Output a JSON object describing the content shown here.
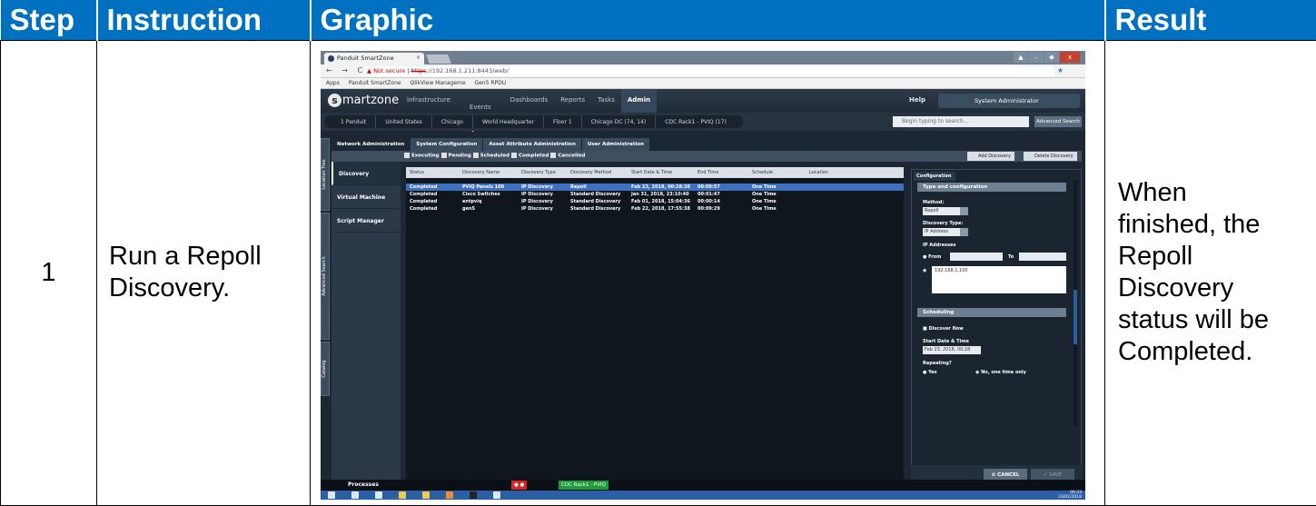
{
  "table": {
    "headers": [
      "Step",
      "Instruction",
      "Graphic",
      "Result"
    ],
    "row": {
      "step": "1",
      "instruction_lines": [
        "Run a Repoll",
        "Discovery."
      ],
      "result_lines": [
        "When",
        "finished, the",
        "Repoll",
        "Discovery",
        "status will be",
        "Completed."
      ]
    }
  },
  "screenshot": {
    "browser_tab": "Panduit SmartZone",
    "tab_close": "×",
    "window_controls": [
      "▲",
      "–",
      "◆",
      "x"
    ],
    "nav_glyphs": "← → C",
    "url_not_secure": "▲ Not secure",
    "url_https": "https",
    "url_rest": "://192.168.1.211:8443/web/",
    "bookmarks": [
      "Apps",
      "Panduit SmartZone",
      "QlikView Manageme",
      "Gen5 RPDU"
    ],
    "logo_initial": "s",
    "logo_text": "martzone",
    "main_nav": [
      "Infrastructure",
      "Events",
      "Dashboards",
      "Reports",
      "Tasks",
      "Admin"
    ],
    "events_badge": "1",
    "help": "Help",
    "user": "System Administrator",
    "breadcrumbs": [
      "1 Panduit",
      "United States",
      "Chicago",
      "World Headquarter",
      "Floor 1",
      "Chicago DC (74, 14)",
      "CDC Rack1 - PVIQ (17)"
    ],
    "search_placeholder": "Begin typing to search...",
    "advanced_search": "Advanced Search",
    "side_tabs": [
      "Location Tree",
      "Advanced Search",
      "Catalog"
    ],
    "admin_tabs": [
      "Network Administration",
      "System Configuration",
      "Asset Attribute Administration",
      "User Administration"
    ],
    "filters": [
      "Executing",
      "Pending",
      "Scheduled",
      "Completed",
      "Cancelled"
    ],
    "add_discovery": "Add Discovery",
    "delete_discovery": "Delete Discovery",
    "left_nav": [
      "Discovery",
      "Virtual Machine",
      "Script Manager"
    ],
    "grid_headers": [
      "Status",
      "Discovery Name",
      "Discovery Type",
      "Discovery Method",
      "Start Date & Time",
      "End Time",
      "Schedule",
      "Location"
    ],
    "grid_rows": [
      [
        "Completed",
        "PVIQ Panels 100",
        "IP Discovery",
        "Repoll",
        "Feb 23, 2018, 00:28:38",
        "00:09:57",
        "One Time",
        ""
      ],
      [
        "Completed",
        "Cisco Switches",
        "IP Discovery",
        "Standard Discovery",
        "Jan 31, 2018, 23:10:40",
        "00:01:47",
        "One Time",
        ""
      ],
      [
        "Completed",
        "entpviq",
        "IP Discovery",
        "Standard Discovery",
        "Feb 01, 2018, 15:04:36",
        "00:00:14",
        "One Time",
        ""
      ],
      [
        "Completed",
        "gen5",
        "IP Discovery",
        "Standard Discovery",
        "Feb 22, 2018, 17:55:38",
        "00:09:29",
        "One Time",
        ""
      ]
    ],
    "config": {
      "tab": "Configuration",
      "section_type": "Type and configuration",
      "method_label": "Method:",
      "method_value": "Repoll",
      "discovery_type_label": "Discovery Type:",
      "discovery_type_value": "IP Address",
      "ip_addresses_label": "IP Addresses",
      "from_label": "From",
      "to_label": "To",
      "ip_value": "192.168.1.100",
      "section_scheduling": "Scheduling",
      "discover_now": "Discover Now",
      "start_label": "Start Date & Time",
      "start_value": "Feb 23, 2018, 00:28",
      "repeating_label": "Repeating?",
      "yes": "Yes",
      "no": "No, one time only",
      "cancel": "CANCEL",
      "save": "SAVE"
    },
    "processes": "Processes",
    "process_tab": "CDC Rack1 - PVIQ",
    "clock_time": "00:43",
    "clock_date": "23/02/2018"
  }
}
